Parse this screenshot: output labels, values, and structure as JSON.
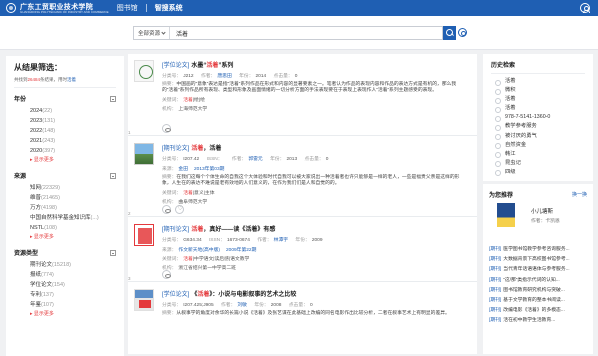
{
  "header": {
    "school_name": "广东工贸职业技术学院",
    "school_name_en": "GUANGDONG POLYTECHNIC OF INDUSTRY AND COMMERCE",
    "library_label": "图书馆",
    "system_title": "智搜系统"
  },
  "search": {
    "scope": "全部资源",
    "query": "活着"
  },
  "filters": {
    "title": "从结果筛选：",
    "hit_prefix": "共找到",
    "hit_count": "26484",
    "hit_middle": "条结果，用时",
    "hit_suffix": "",
    "year": {
      "label": "年份",
      "items": [
        {
          "name": "2024",
          "count": "(22)"
        },
        {
          "name": "2023",
          "count": "(131)"
        },
        {
          "name": "2022",
          "count": "(148)"
        },
        {
          "name": "2021",
          "count": "(243)"
        },
        {
          "name": "2020",
          "count": "(397)"
        }
      ],
      "more": "显示更多"
    },
    "source": {
      "label": "来源",
      "items": [
        {
          "name": "知网",
          "count": "(22329)"
        },
        {
          "name": "维普",
          "count": "(21465)"
        },
        {
          "name": "万方",
          "count": "(4198)"
        },
        {
          "name": "中国自然科学基金知识库",
          "count": "(...)"
        },
        {
          "name": "NSTL",
          "count": "(108)"
        }
      ],
      "more": "显示更多"
    },
    "type": {
      "label": "资源类型",
      "items": [
        {
          "name": "期刊论文",
          "count": "(15218)"
        },
        {
          "name": "报纸",
          "count": "(774)"
        },
        {
          "name": "学位论文",
          "count": "(154)"
        },
        {
          "name": "专利",
          "count": "(137)"
        },
        {
          "name": "年鉴",
          "count": "(107)"
        }
      ],
      "more": "显示更多"
    }
  },
  "results": [
    {
      "index": "1",
      "tag": "[学位论文]",
      "title_pre": "水墨“",
      "title_hl": "活着",
      "title_post": "”系列",
      "meta": [
        {
          "label": "分类号：",
          "value": "J212"
        },
        {
          "label": "作者：",
          "value": "唐思田",
          "link": true
        },
        {
          "label": "年份：",
          "value": "2014"
        },
        {
          "label": "点击量：",
          "value": "0"
        }
      ],
      "abstract_label": "摘要：",
      "abstract": "中国画的“意象”表达是指“活着”系列作品在形式和内容的显著要素之一。笔者认为作品的表现内容和作品的表达方式是有机的，那么我的“活着”系列作品所有表现、类型和形象及画面情绪的一切分析方面的手法表现要在于表现上表现作人“活着”系列主题感受的表现。",
      "keywords_label": "关键词：",
      "keywords_hl": "活着",
      "keywords_rest": "|绘|绘",
      "org_label": "机构：",
      "org": "上海师范大学"
    },
    {
      "index": "2",
      "tag": "[期刊论文]",
      "title_pre": "",
      "title_hl": "活着",
      "title_post": "，活着",
      "meta": [
        {
          "label": "分类号：",
          "value": "I207.42"
        },
        {
          "label": "ISSN：",
          "value": ""
        },
        {
          "label": "作者：",
          "value": "郭雷元",
          "link": true
        },
        {
          "label": "年份：",
          "value": "2013"
        },
        {
          "label": "点击量：",
          "value": "0"
        }
      ],
      "source_label": "来源：",
      "source": "金田",
      "issue": "2013年第03期",
      "abstract_label": "摘要：",
      "abstract": "在我们这每个个体生命的自我这个大体验和时代自我可以被大家说出一种活着者也许只能够是一样的老人，一些是福贵父亲是这样的形象，人生在的表达不难说是老有效地的人们意义的，在作为我们们是人和自觉的的。",
      "keywords_label": "关键词：",
      "keywords_hl": "活着",
      "keywords_rest": "|意义|主体",
      "org_label": "机构：",
      "org": "曲阜师范大学"
    },
    {
      "index": "3",
      "tag": "[期刊论文]",
      "title_pre": "",
      "title_hl": "活着",
      "title_post": "，真好——读《活着》有感",
      "meta": [
        {
          "label": "分类号：",
          "value": "G634.34"
        },
        {
          "label": "ISSN：",
          "value": "1673-0674"
        },
        {
          "label": "作者：",
          "value": "林潭宇",
          "link": true
        },
        {
          "label": "年份：",
          "value": "2009"
        }
      ],
      "source_label": "来源：",
      "source": "作文新天地(高中版)",
      "issue": "2009年第22期",
      "keywords_label": "关键词：",
      "keywords_hl": "活着",
      "keywords_rest": "|中学语文|读后感|语文教学",
      "org_label": "机构：",
      "org": "浙江省绍兴第一中学高二班"
    },
    {
      "index": "4",
      "tag": "[学位论文]",
      "title_pre": "《",
      "title_hl": "活着",
      "title_post": "》：小说与电影叙事的艺术之比较",
      "meta": [
        {
          "label": "分类号：",
          "value": "I207.425;J905"
        },
        {
          "label": "作者：",
          "value": "刘敏",
          "link": true
        },
        {
          "label": "年份：",
          "value": "2008"
        },
        {
          "label": "点击量：",
          "value": "0"
        }
      ],
      "abstract_label": "摘要：",
      "abstract": "从叙事学的角度对余华的长篇小说《活着》及张艺谋在此基础上改编的同名电影作出比较分析，二者在叙事艺术上有明显的差异。"
    }
  ],
  "history": {
    "title": "历史检索",
    "items": [
      "活着",
      "微积",
      "活着",
      "活着",
      "978-7-5141-1360-0",
      "教学参考服务",
      "被讨厌的勇气",
      "自然资金",
      "韩江",
      "昆虫记",
      "四级"
    ]
  },
  "recommend": {
    "title": "为您推荐",
    "refresh": "换一换",
    "book_name": "小儿塘斯",
    "book_author": "作者：卡凯恩",
    "items": [
      {
        "tag": "[期刊]",
        "text": "医学图书馆教学参考咨询服务..."
      },
      {
        "tag": "[期刊]",
        "text": "大数据背景下高校图书馆参考..."
      },
      {
        "tag": "[期刊]",
        "text": "当代青年话语语体与参考服务..."
      },
      {
        "tag": "[期刊]",
        "text": "“这/那”类指示代词的认知..."
      },
      {
        "tag": "[期刊]",
        "text": "图书馆教育研究机构与突破..."
      },
      {
        "tag": "[期刊]",
        "text": "基于文学教育的整本书阅读..."
      },
      {
        "tag": "[期刊]",
        "text": "改编电影《活着》的多模态..."
      },
      {
        "tag": "[期刊]",
        "text": "活在初中教学生活教育..."
      }
    ]
  }
}
